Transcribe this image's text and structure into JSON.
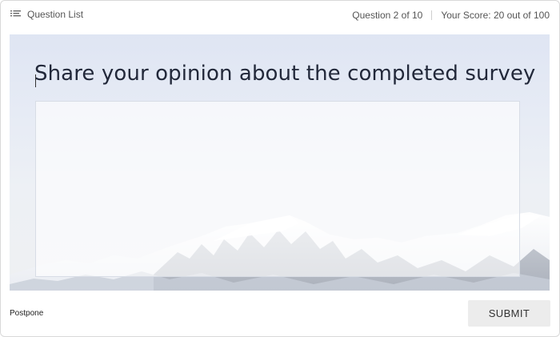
{
  "header": {
    "question_list_label": "Question List",
    "progress": "Question 2 of 10",
    "score": "Your Score: 20 out of 100"
  },
  "question": {
    "title": "Share your opinion about the completed survey",
    "answer_value": ""
  },
  "footer": {
    "postpone_label": "Postpone",
    "submit_label": "SUBMIT"
  },
  "icons": {
    "question_list": "list-icon"
  },
  "colors": {
    "title": "#22283a",
    "submit_bg": "#ececec",
    "sky_top": "#dfe5f3"
  }
}
